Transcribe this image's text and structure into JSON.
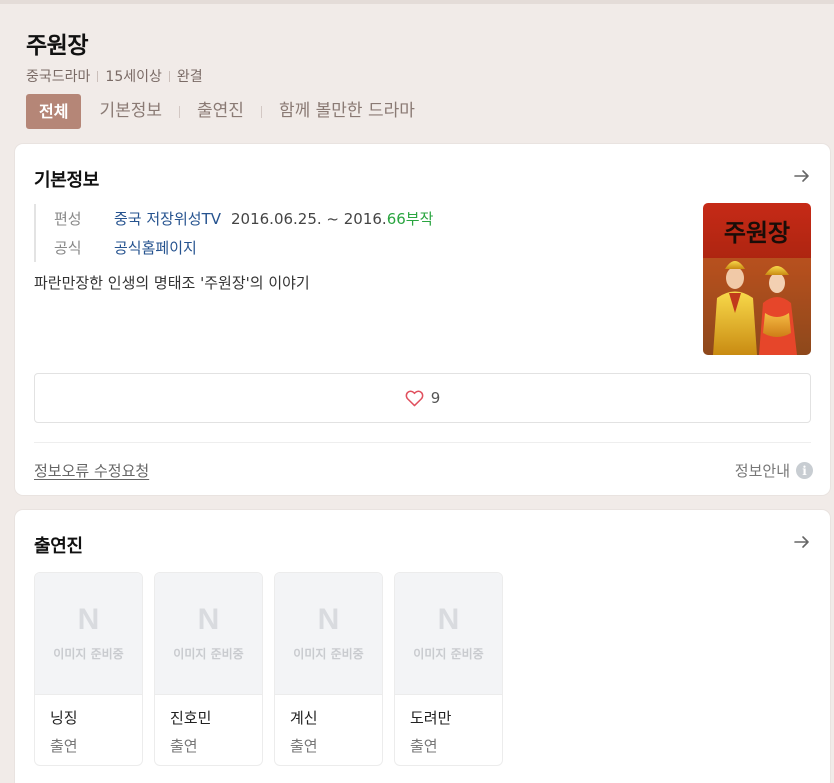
{
  "header": {
    "title": "주원장",
    "meta": [
      "중국드라마",
      "15세이상",
      "완결"
    ],
    "tabs": [
      {
        "label": "전체",
        "active": true
      },
      {
        "label": "기본정보",
        "active": false
      },
      {
        "label": "출연진",
        "active": false
      },
      {
        "label": "함께 볼만한 드라마",
        "active": false
      }
    ]
  },
  "basic_info": {
    "title": "기본정보",
    "broadcast_label": "편성",
    "broadcaster": "중국 저장위성TV",
    "date_range": "2016.06.25. ~ 2016.",
    "episodes": "66부작",
    "official_label": "공식",
    "official_link": "공식홈페이지",
    "synopsis": "파란만장한 인생의 명태조 '주원장'의 이야기",
    "poster_text": "주원장",
    "likes": "9",
    "report_link": "정보오류 수정요청",
    "info_guide": "정보안내",
    "info_icon": "i"
  },
  "cast": {
    "title": "출연진",
    "placeholder_logo": "N",
    "placeholder_text": "이미지 준비중",
    "members": [
      {
        "name": "닝징",
        "role": "출연"
      },
      {
        "name": "진호민",
        "role": "출연"
      },
      {
        "name": "계신",
        "role": "출연"
      },
      {
        "name": "도려만",
        "role": "출연"
      }
    ]
  },
  "colors": {
    "accent": "#b58677",
    "background": "#f1ebe8",
    "link": "#26538f",
    "green": "#2aa540"
  }
}
